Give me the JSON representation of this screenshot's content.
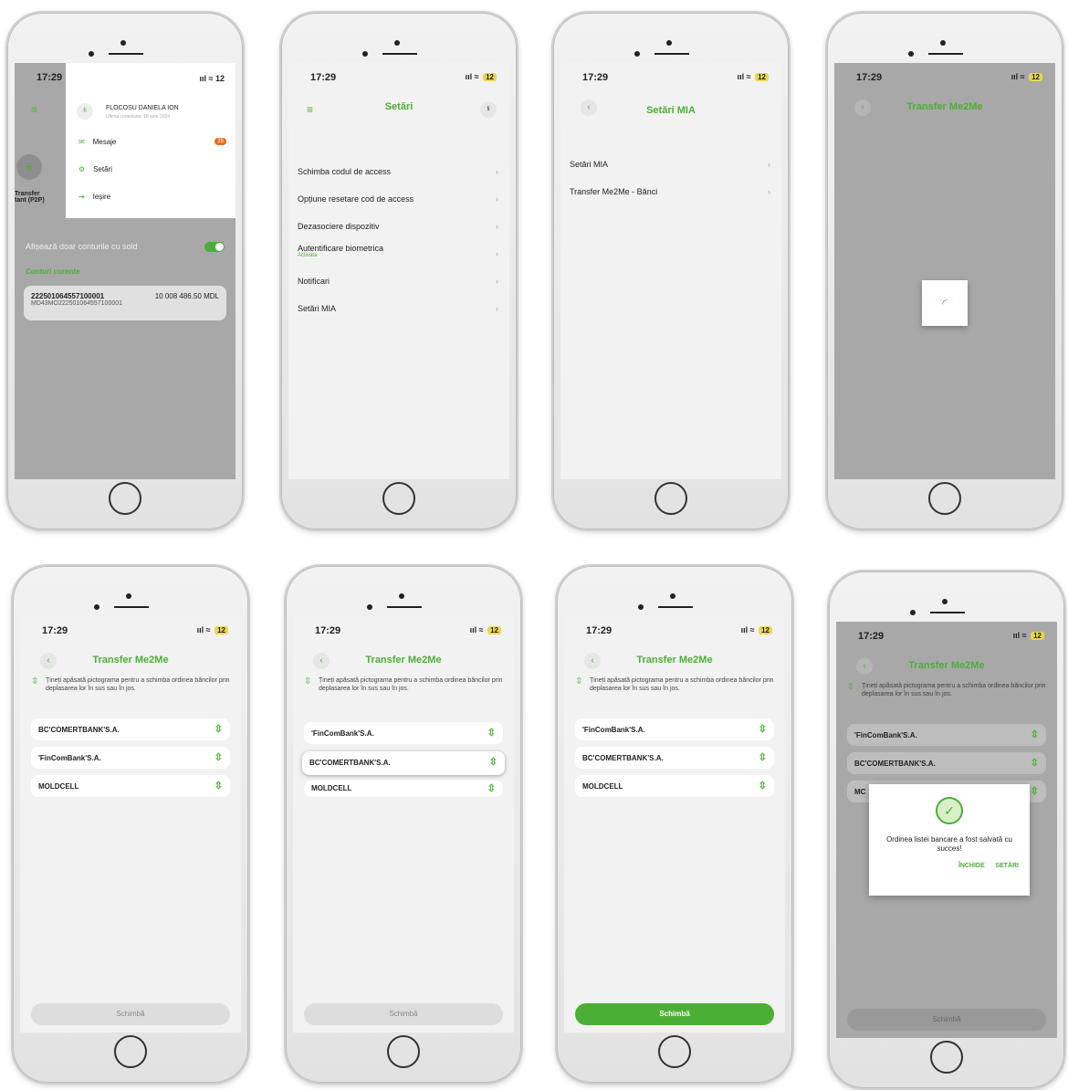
{
  "status": {
    "time": "17:29",
    "battery": "12",
    "signal": "ııl ≈"
  },
  "p1": {
    "user_name": "FLOCOSU DANIELA ION",
    "user_sub": "Ultima conexiune: 18 iune 2024",
    "menu": [
      {
        "label": "Mesaje",
        "badge": "25"
      },
      {
        "label": "Setări"
      },
      {
        "label": "Ieșire"
      }
    ],
    "side_label": "Transfer tant (P2P)",
    "toggle_label": "Afișează doar conturile cu sold",
    "section": "Conturi curente",
    "account_no": "222501064557100001",
    "account_iban": "MD43MO222501064557100001",
    "account_balance": "10 008 486.50 MDL"
  },
  "p2": {
    "title": "Setări",
    "items": [
      {
        "label": "Schimba codul de access"
      },
      {
        "label": "Opțiune resetare cod de access"
      },
      {
        "label": "Dezasociere dispozitiv"
      },
      {
        "label": "Autentificare biometrica",
        "sub": "Activata"
      },
      {
        "label": "Notificari"
      },
      {
        "label": "Setări MIA"
      }
    ]
  },
  "p3": {
    "title": "Setări MIA",
    "items": [
      {
        "label": "Setări MIA"
      },
      {
        "label": "Transfer Me2Me - Bănci"
      }
    ]
  },
  "p4": {
    "title": "Transfer Me2Me"
  },
  "transfer": {
    "title": "Transfer Me2Me",
    "hint": "Țineți apăsată pictograma pentru a schimba ordinea băncilor prin deplasarea lor în sus sau în jos.",
    "button": "Schimbă"
  },
  "p5": {
    "banks": [
      "BC'COMERTBANK'S.A.",
      "'FinComBank'S.A.",
      "MOLDCELL"
    ]
  },
  "p6": {
    "banks": [
      "'FinComBank'S.A.",
      "BC'COMERTBANK'S.A.",
      "MOLDCELL"
    ]
  },
  "p7": {
    "banks": [
      "'FinComBank'S.A.",
      "BC'COMERTBANK'S.A.",
      "MOLDCELL"
    ]
  },
  "p8": {
    "banks": [
      "'FinComBank'S.A.",
      "BC'COMERTBANK'S.A.",
      "MC"
    ],
    "dialog_msg": "Ordinea listei bancare a fost salvată cu succes!",
    "close": "ÎNCHIDE",
    "settings": "SETĂRI"
  },
  "colors": {
    "accent": "#4caf35",
    "badge": "#ef6c1a"
  }
}
